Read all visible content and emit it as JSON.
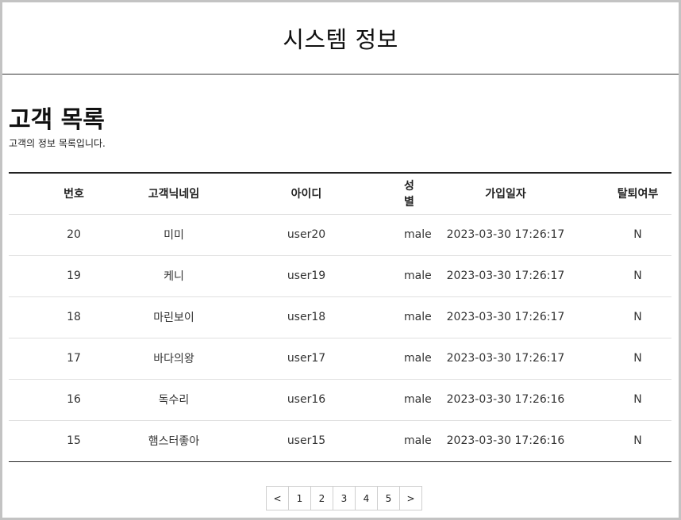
{
  "header": {
    "title": "시스템 정보"
  },
  "section": {
    "title": "고객 목록",
    "description": "고객의 정보 목록입니다."
  },
  "table": {
    "columns": [
      "번호",
      "고객닉네임",
      "아이디",
      "성별",
      "가입일자",
      "탈퇴여부"
    ],
    "rows": [
      [
        "20",
        "미미",
        "user20",
        "male",
        "2023-03-30 17:26:17",
        "N"
      ],
      [
        "19",
        "케니",
        "user19",
        "male",
        "2023-03-30 17:26:17",
        "N"
      ],
      [
        "18",
        "마린보이",
        "user18",
        "male",
        "2023-03-30 17:26:17",
        "N"
      ],
      [
        "17",
        "바다의왕",
        "user17",
        "male",
        "2023-03-30 17:26:17",
        "N"
      ],
      [
        "16",
        "독수리",
        "user16",
        "male",
        "2023-03-30 17:26:16",
        "N"
      ],
      [
        "15",
        "햄스터좋아",
        "user15",
        "male",
        "2023-03-30 17:26:16",
        "N"
      ]
    ]
  },
  "pagination": {
    "prev": "<",
    "pages": [
      "1",
      "2",
      "3",
      "4",
      "5"
    ],
    "next": ">"
  }
}
